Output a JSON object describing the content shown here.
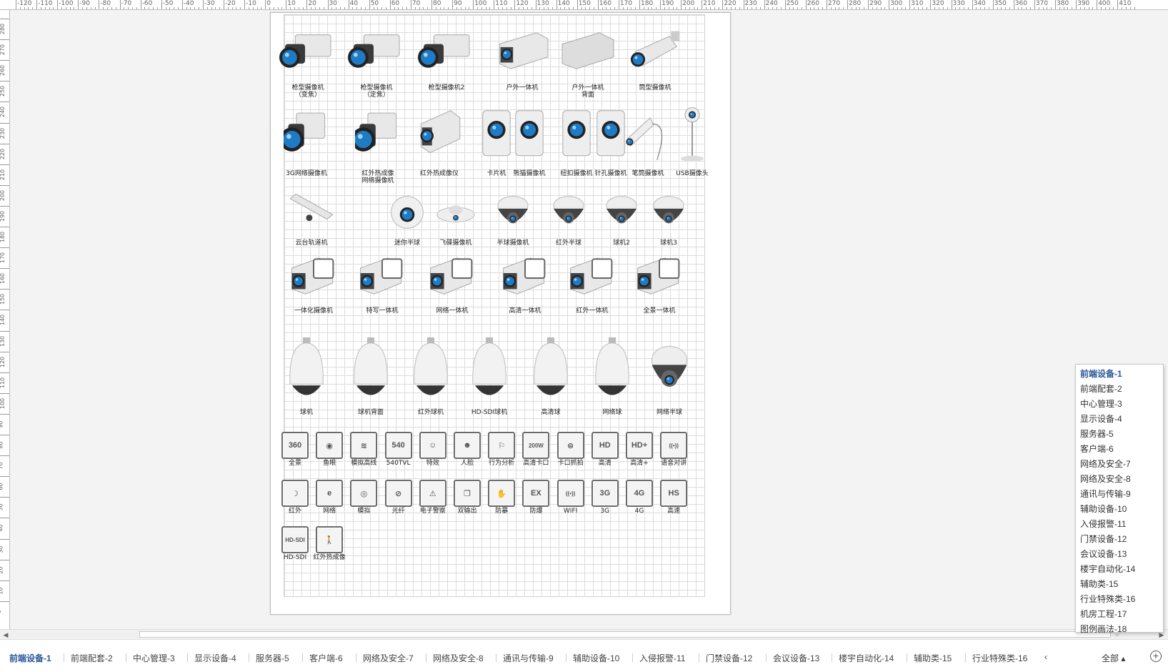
{
  "rulers": {
    "top_labels": [
      "-120",
      "-110",
      "-100",
      "-90",
      "-80",
      "-70",
      "-60",
      "-50",
      "-40",
      "-30",
      "-20",
      "-10",
      "0",
      "10",
      "20",
      "30",
      "40",
      "50",
      "60",
      "70",
      "80",
      "90",
      "100",
      "110",
      "120",
      "130",
      "140",
      "150",
      "160",
      "170",
      "180",
      "190",
      "200",
      "210",
      "220",
      "230",
      "240",
      "250",
      "260",
      "270",
      "280",
      "290",
      "300",
      "310",
      "320",
      "330",
      "340",
      "350",
      "360",
      "370",
      "380",
      "390",
      "400",
      "410"
    ],
    "left_labels": [
      "280",
      "270",
      "260",
      "250",
      "240",
      "230",
      "220",
      "210",
      "200",
      "190",
      "180",
      "170",
      "160",
      "150",
      "140",
      "130",
      "120",
      "110",
      "100",
      "90",
      "80",
      "70",
      "60",
      "50",
      "40",
      "30",
      "20",
      "10",
      "0"
    ]
  },
  "stencil": {
    "row1": [
      {
        "label": "枪型摄像机\n（变焦）",
        "icon": "box-camera-zoom-icon"
      },
      {
        "label": "枪型摄像机\n（定焦）",
        "icon": "box-camera-fixed-icon"
      },
      {
        "label": "枪型摄像机2",
        "icon": "box-camera-2-icon"
      },
      {
        "label": "户外一体机",
        "icon": "outdoor-camera-icon"
      },
      {
        "label": "户外一体机\n背面",
        "icon": "outdoor-camera-back-icon"
      },
      {
        "label": "筒型摄像机",
        "icon": "bullet-camera-icon"
      }
    ],
    "row2": [
      {
        "label": "3G网络摄像机",
        "icon": "3g-camera-icon"
      },
      {
        "label": "红外热成像\n网络摄像机",
        "icon": "thermal-network-camera-icon"
      },
      {
        "label": "红外热成像仪",
        "icon": "thermal-imager-icon"
      },
      {
        "label": "卡片机",
        "icon": "card-camera-icon"
      },
      {
        "label": "熊猫摄像机",
        "icon": "panda-camera-icon"
      },
      {
        "label": "纽扣摄像机",
        "icon": "button-camera-icon"
      },
      {
        "label": "针孔摄像机",
        "icon": "pinhole-camera-icon"
      },
      {
        "label": "笔筒摄像机",
        "icon": "pen-camera-icon"
      },
      {
        "label": "USB摄像头",
        "icon": "usb-camera-icon"
      }
    ],
    "row3": [
      {
        "label": "云台轨道机",
        "icon": "ptz-rail-icon"
      },
      {
        "label": "迷你半球",
        "icon": "mini-dome-icon"
      },
      {
        "label": "飞碟摄像机",
        "icon": "ufo-camera-icon"
      },
      {
        "label": "半球摄像机",
        "icon": "dome-camera-icon"
      },
      {
        "label": "红外半球",
        "icon": "ir-dome-icon"
      },
      {
        "label": "球机2",
        "icon": "speed-dome-2-icon"
      },
      {
        "label": "球机3",
        "icon": "speed-dome-3-icon"
      }
    ],
    "row4": [
      {
        "label": "一体化摄像机",
        "icon": "integrated-camera-icon"
      },
      {
        "label": "特写一体机",
        "icon": "closeup-camera-icon"
      },
      {
        "label": "网络一体机",
        "icon": "network-camera-icon"
      },
      {
        "label": "高清一体机",
        "icon": "hd-camera-icon"
      },
      {
        "label": "红外一体机",
        "icon": "ir-camera-icon"
      },
      {
        "label": "全景一体机",
        "icon": "panoramic-camera-icon"
      }
    ],
    "row5": [
      {
        "label": "球机",
        "icon": "ptz-dome-icon"
      },
      {
        "label": "球机背面",
        "icon": "ptz-dome-back-icon"
      },
      {
        "label": "红外球机",
        "icon": "ir-ptz-dome-icon"
      },
      {
        "label": "HD-SDI球机",
        "icon": "hdsdi-dome-icon"
      },
      {
        "label": "高清球",
        "icon": "hd-dome-icon"
      },
      {
        "label": "网络球",
        "icon": "network-dome-icon"
      },
      {
        "label": "网络半球",
        "icon": "network-half-dome-icon"
      }
    ],
    "row6": [
      {
        "label": "全景",
        "glyph": "360"
      },
      {
        "label": "鱼眼",
        "glyph": "◉"
      },
      {
        "label": "模拟高线",
        "glyph": "≋"
      },
      {
        "label": "540TVL",
        "glyph": "540"
      },
      {
        "label": "特效",
        "glyph": "☺"
      },
      {
        "label": "人脸",
        "glyph": "☻"
      },
      {
        "label": "行为分析",
        "glyph": "⚐"
      },
      {
        "label": "高清卡口",
        "glyph": "200W"
      },
      {
        "label": "卡口抓拍",
        "glyph": "⊜"
      },
      {
        "label": "高清",
        "glyph": "HD"
      },
      {
        "label": "高清+",
        "glyph": "HD+"
      },
      {
        "label": "语音对讲",
        "glyph": "((•))"
      }
    ],
    "row7": [
      {
        "label": "红外",
        "glyph": "☽"
      },
      {
        "label": "网络",
        "glyph": "e"
      },
      {
        "label": "模拟",
        "glyph": "◎"
      },
      {
        "label": "光纤",
        "glyph": "⊘"
      },
      {
        "label": "电子警察",
        "glyph": "⚠"
      },
      {
        "label": "双输出",
        "glyph": "❐"
      },
      {
        "label": "防暴",
        "glyph": "✋"
      },
      {
        "label": "防爆",
        "glyph": "EX"
      },
      {
        "label": "WIFI",
        "glyph": "((•))"
      },
      {
        "label": "3G",
        "glyph": "3G"
      },
      {
        "label": "4G",
        "glyph": "4G"
      },
      {
        "label": "高速",
        "glyph": "HS"
      }
    ],
    "row8": [
      {
        "label": "HD-SDI",
        "glyph": "HD-SDI"
      },
      {
        "label": "红外热成像",
        "glyph": "🚶"
      }
    ]
  },
  "tabs": [
    "前端设备-1",
    "前端配套-2",
    "中心管理-3",
    "显示设备-4",
    "服务器-5",
    "客户端-6",
    "网络及安全-7",
    "网络及安全-8",
    "通讯与传输-9",
    "辅助设备-10",
    "入侵报警-11",
    "门禁设备-12",
    "会议设备-13",
    "楼宇自动化-14",
    "辅助类-15",
    "行业特殊类-16"
  ],
  "tab_overflow": "‹",
  "tab_all_label": "全部 ▴",
  "add_label": "+",
  "popup_items": [
    "前端设备-1",
    "前端配套-2",
    "中心管理-3",
    "显示设备-4",
    "服务器-5",
    "客户端-6",
    "网络及安全-7",
    "网络及安全-8",
    "通讯与传输-9",
    "辅助设备-10",
    "入侵报警-11",
    "门禁设备-12",
    "会议设备-13",
    "楼宇自动化-14",
    "辅助类-15",
    "行业特殊类-16",
    "机房工程-17",
    "图例画法-18"
  ],
  "active_tab": "前端设备-1",
  "colors": {
    "accent": "#2b579a",
    "lens": "#1e7bc4",
    "camera_body": "#e8e8e8",
    "camera_dark": "#3a3a3a"
  }
}
